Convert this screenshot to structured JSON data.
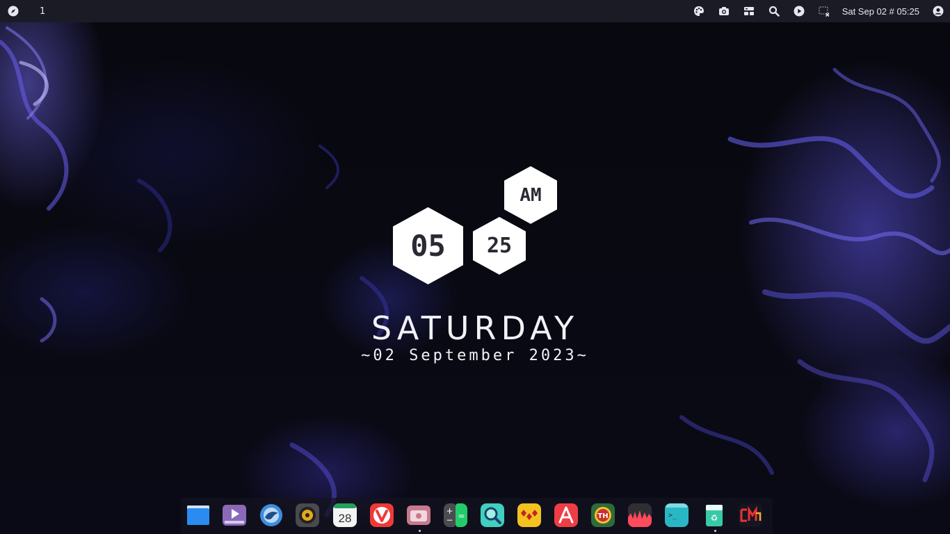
{
  "topbar": {
    "workspace": "1",
    "clock": "Sat Sep 02 # 05:25",
    "left_icon": "compass-icon",
    "right_icons": [
      "palette-icon",
      "camera-icon",
      "layout-icon",
      "search-icon",
      "play-icon",
      "screen-close-icon",
      "user-icon"
    ]
  },
  "clock_widget": {
    "hour": "05",
    "minute": "25",
    "ampm": "AM",
    "day": "SATURDAY",
    "date": "~02 September 2023~"
  },
  "dock": {
    "items": [
      {
        "name": "files-app",
        "icon": "blue-window-icon"
      },
      {
        "name": "video-player",
        "icon": "purple-play-icon"
      },
      {
        "name": "mail-app",
        "icon": "bird-icon"
      },
      {
        "name": "music-app",
        "icon": "record-icon"
      },
      {
        "name": "calendar-app",
        "icon": "calendar-icon",
        "label": "28"
      },
      {
        "name": "vivaldi-browser",
        "icon": "vivaldi-icon"
      },
      {
        "name": "photos-app",
        "icon": "camera-folder-icon"
      },
      {
        "name": "calculator-app",
        "icon": "calculator-icon"
      },
      {
        "name": "search-app",
        "icon": "magnifier-icon"
      },
      {
        "name": "dots-app",
        "icon": "red-dots-icon"
      },
      {
        "name": "app-store",
        "icon": "app-store-icon"
      },
      {
        "name": "th-app",
        "icon": "th-badge-icon",
        "label": "TH"
      },
      {
        "name": "audio-app",
        "icon": "waveform-icon"
      },
      {
        "name": "terminal-app",
        "icon": "terminal-icon"
      },
      {
        "name": "trash-app",
        "icon": "recycle-bin-icon"
      },
      {
        "name": "cm-app",
        "icon": "cm-logo-icon"
      }
    ]
  },
  "colors": {
    "topbar_bg": "#1b1b26",
    "hex_bg": "#ffffff",
    "accent": "#5b55e0"
  }
}
